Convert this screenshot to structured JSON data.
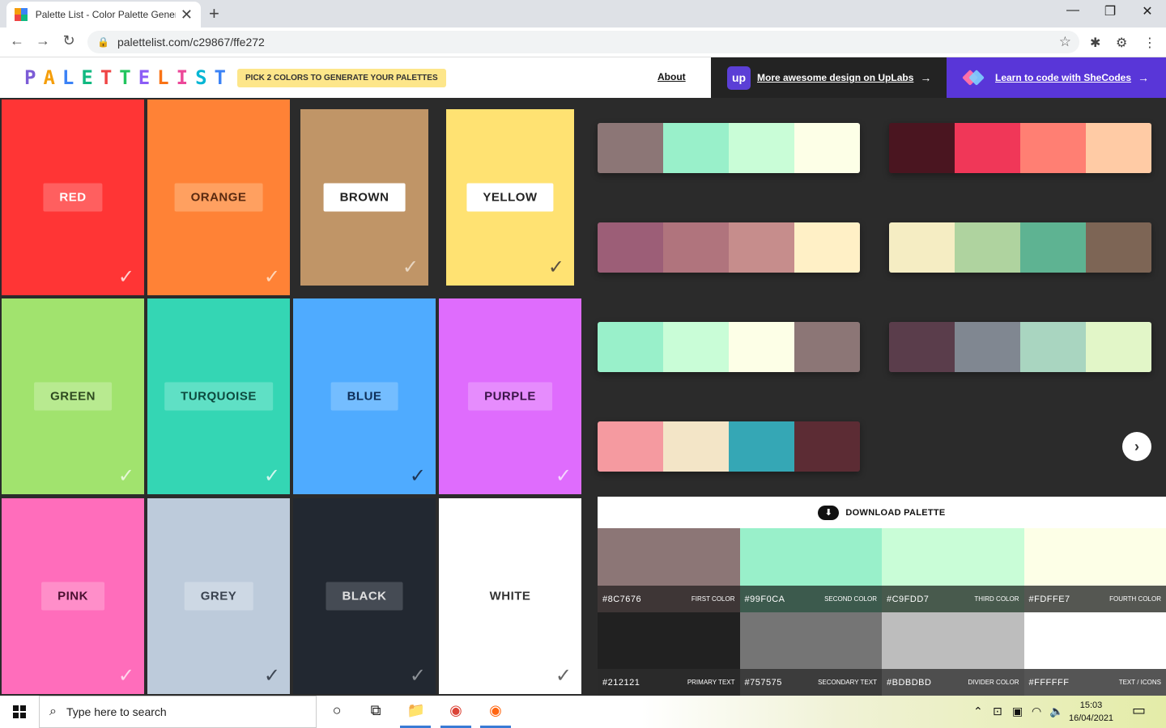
{
  "browser": {
    "tab_title": "Palette List - Color Palette Generator",
    "tab_close": "✕",
    "new_tab": "+",
    "url": "palettelist.com/c29867/ffe272",
    "back": "←",
    "forward": "→",
    "reload": "↻",
    "minimize": "—",
    "maximize": "❐",
    "close": "✕",
    "lock": "🔒",
    "star": "☆",
    "extensions": "✱",
    "profile": "⚙",
    "menu": "⋮"
  },
  "site": {
    "logo_letters": [
      "P",
      "A",
      "L",
      "E",
      "T",
      "T",
      "E",
      "L",
      "I",
      "S",
      "T"
    ],
    "logo_colors": [
      "#7c5cd6",
      "#f59e0b",
      "#3b82f6",
      "#10b981",
      "#ef4444",
      "#22c55e",
      "#8b5cf6",
      "#f97316",
      "#ec4899",
      "#06b6d4",
      "#3b82f6"
    ],
    "pick_hint": "PICK 2 COLORS TO GENERATE YOUR PALETTES",
    "about": "About",
    "uplabs_logo": "up",
    "uplabs_text": "More awesome design on UpLabs",
    "shecodes_text": "Learn to code with SheCodes",
    "arrow": "→"
  },
  "colors": [
    {
      "label": "RED",
      "bg": "#ff3535",
      "label_bg": "#ff5f5f",
      "label_fg": "#ffffff",
      "check": "✓",
      "check_color": "#ffd0d0"
    },
    {
      "label": "ORANGE",
      "bg": "#ff8236",
      "label_bg": "#ffa060",
      "label_fg": "#5a2a10",
      "check": "✓",
      "check_color": "#ffd6b8"
    },
    {
      "label": "BROWN",
      "bg": "#c09567",
      "label_bg": "#ffffff",
      "label_fg": "#222222",
      "check": "✓",
      "check_color": "#e8d6c2",
      "selected": true
    },
    {
      "label": "YELLOW",
      "bg": "#ffe272",
      "label_bg": "#ffffff",
      "label_fg": "#222222",
      "check": "✓",
      "check_color": "#5a5040",
      "selected": true
    },
    {
      "label": "GREEN",
      "bg": "#a1e36e",
      "label_bg": "#b8ea90",
      "label_fg": "#2e4a20",
      "check": "✓",
      "check_color": "#e6f7d6"
    },
    {
      "label": "TURQUOISE",
      "bg": "#34d6b4",
      "label_bg": "#5fe0c5",
      "label_fg": "#0d4a3f",
      "check": "✓",
      "check_color": "#d2f6ee"
    },
    {
      "label": "BLUE",
      "bg": "#4fabff",
      "label_bg": "#74bdff",
      "label_fg": "#0e2e58",
      "check": "✓",
      "check_color": "#1e3556"
    },
    {
      "label": "PURPLE",
      "bg": "#df6cfd",
      "label_bg": "#e68cfd",
      "label_fg": "#3a1448",
      "check": "✓",
      "check_color": "#f4d4fd"
    },
    {
      "label": "PINK",
      "bg": "#ff6dbb",
      "label_bg": "#ff8ec9",
      "label_fg": "#4a1030",
      "check": "✓",
      "check_color": "#ffd6ec"
    },
    {
      "label": "GREY",
      "bg": "#bdcbdb",
      "label_bg": "#cdd8e4",
      "label_fg": "#3a4350",
      "check": "✓",
      "check_color": "#3e4754"
    },
    {
      "label": "BLACK",
      "bg": "#222831",
      "label_bg": "#454b54",
      "label_fg": "#e0e0e0",
      "check": "✓",
      "check_color": "#8c9096"
    },
    {
      "label": "WHITE",
      "bg": "#ffffff",
      "label_bg": "#ffffff",
      "label_fg": "#333333",
      "check": "✓",
      "check_color": "#666666"
    }
  ],
  "palettes": [
    [
      "#8c7676",
      "#99f0ca",
      "#c9fdd7",
      "#fdffe7"
    ],
    [
      "#4a1520",
      "#f03758",
      "#ff7f73",
      "#ffcba5"
    ],
    [
      "#9c5e77",
      "#b0747d",
      "#c68d8c",
      "#fff0c6"
    ],
    [
      "#f5edc3",
      "#afd39f",
      "#5eb392",
      "#7d6555"
    ],
    [
      "#99f0ca",
      "#c9fdd7",
      "#fdffe7",
      "#8c7676"
    ],
    [
      "#5a3d4b",
      "#808791",
      "#a9d5c0",
      "#e2f6c8"
    ],
    [
      "#f59aa0",
      "#f3e5c7",
      "#35a7b5",
      "#5c2c34"
    ]
  ],
  "next_arrow": "›",
  "detail": {
    "download_label": "DOWNLOAD PALETTE",
    "download_icon": "⬇",
    "swatches": [
      {
        "hex": "#8C7676",
        "role": "FIRST COLOR",
        "bg": "#8c7676",
        "bar": "#3e3636"
      },
      {
        "hex": "#99F0CA",
        "role": "SECOND COLOR",
        "bg": "#99f0ca",
        "bar": "#3c5a4d"
      },
      {
        "hex": "#C9FDD7",
        "role": "THIRD COLOR",
        "bg": "#c9fdd7",
        "bar": "#485a4d"
      },
      {
        "hex": "#FDFFE7",
        "role": "FOURTH COLOR",
        "bg": "#fdffe7",
        "bar": "#555752"
      },
      {
        "hex": "#212121",
        "role": "PRIMARY TEXT",
        "bg": "#212121",
        "bar": "#2a2a2a"
      },
      {
        "hex": "#757575",
        "role": "SECONDARY TEXT",
        "bg": "#757575",
        "bar": "#3c3c3c"
      },
      {
        "hex": "#BDBDBD",
        "role": "DIVIDER COLOR",
        "bg": "#bdbdbd",
        "bar": "#4e4e4e"
      },
      {
        "hex": "#FFFFFF",
        "role": "TEXT / ICONS",
        "bg": "#ffffff",
        "bar": "#555555"
      }
    ]
  },
  "taskbar": {
    "search_placeholder": "Type here to search",
    "search_icon": "⌕",
    "cortana": "○",
    "taskview": "⧉",
    "explorer": "📁",
    "chrome": "◉",
    "firefox": "◉",
    "tray_up": "⌃",
    "tray_meet": "⊡",
    "tray_monitor": "▣",
    "tray_wifi": "◠",
    "tray_volume": "🔈",
    "time": "15:03",
    "date": "16/04/2021",
    "notifications": "▭"
  }
}
